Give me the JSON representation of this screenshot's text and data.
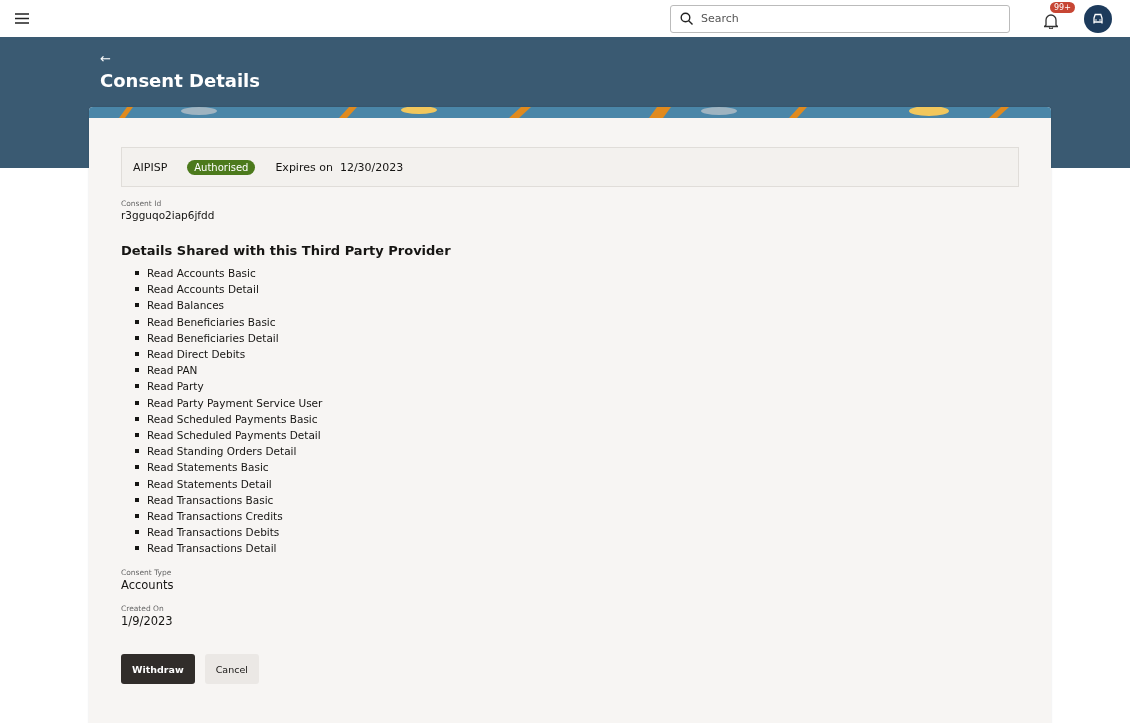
{
  "header": {
    "search": {
      "placeholder": "Search"
    },
    "notifications": {
      "badge": "99+"
    }
  },
  "page": {
    "back": "←",
    "title": "Consent Details"
  },
  "summary": {
    "provider": "AIPISP",
    "status": "Authorised",
    "expires_label": "Expires on",
    "expires": "12/30/2023"
  },
  "consent_id": {
    "label": "Consent Id",
    "value": "r3gguqo2iap6jfdd"
  },
  "details": {
    "heading": "Details Shared with this Third Party Provider",
    "items": [
      "Read Accounts Basic",
      "Read Accounts Detail",
      "Read Balances",
      "Read Beneficiaries Basic",
      "Read Beneficiaries Detail",
      "Read Direct Debits",
      "Read PAN",
      "Read Party",
      "Read Party Payment Service User",
      "Read Scheduled Payments Basic",
      "Read Scheduled Payments Detail",
      "Read Standing Orders Detail",
      "Read Statements Basic",
      "Read Statements Detail",
      "Read Transactions Basic",
      "Read Transactions Credits",
      "Read Transactions Debits",
      "Read Transactions Detail"
    ]
  },
  "fields": [
    {
      "label": "Consent Type",
      "value": "Accounts"
    },
    {
      "label": "Created On",
      "value": "1/9/2023"
    }
  ],
  "buttons": [
    {
      "label": "Withdraw",
      "kind": "primary"
    },
    {
      "label": "Cancel",
      "kind": "secondary"
    }
  ]
}
